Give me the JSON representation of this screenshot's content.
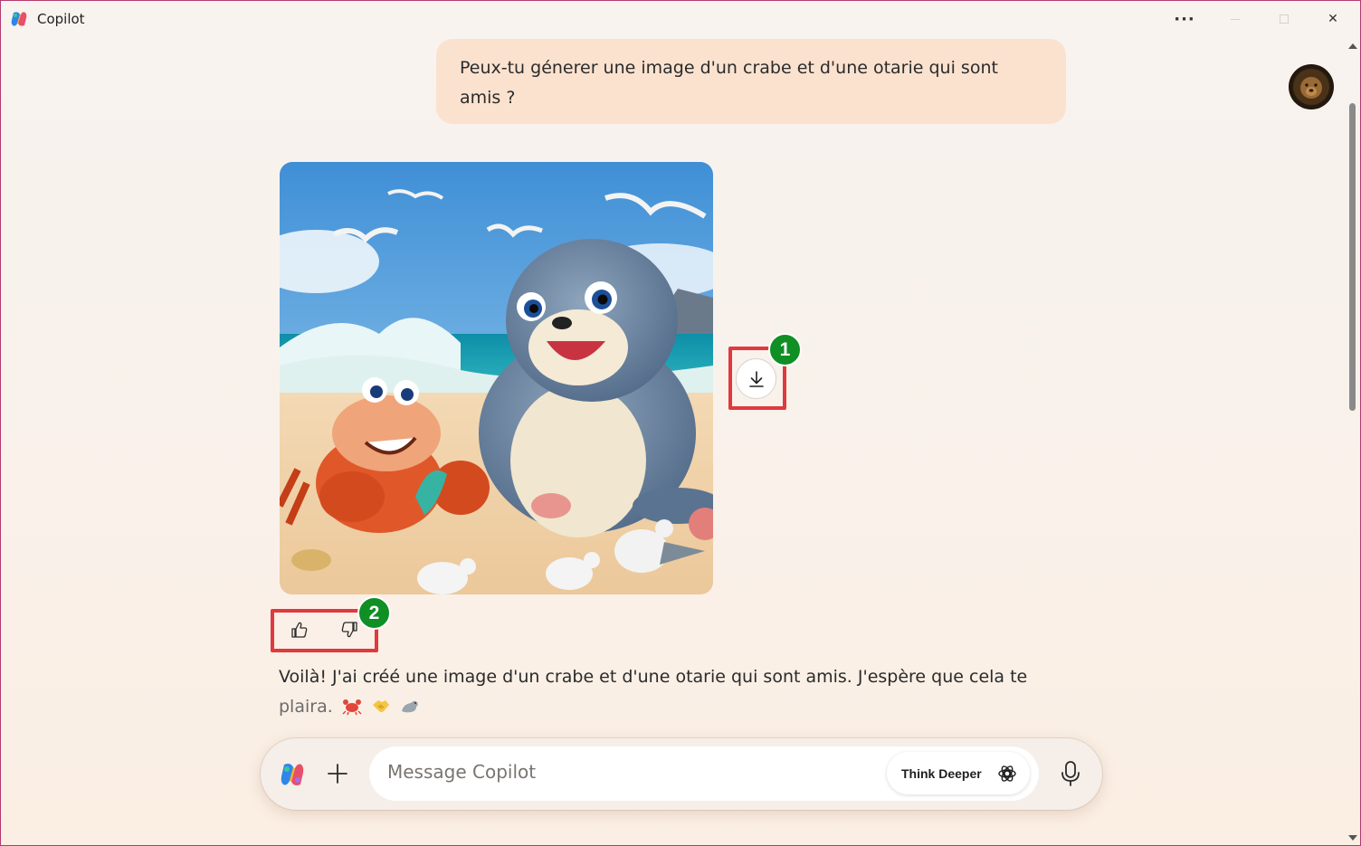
{
  "app": {
    "title": "Copilot",
    "more_glyph": "···",
    "close_glyph": "✕"
  },
  "conversation": {
    "user_message": "Peux-tu génerer une image d'un crabe et d'une otarie qui sont amis ?",
    "response_line1": "Voilà! J'ai créé une image d'un crabe et d'une otarie qui sont amis. J'espère que cela te",
    "response_line2": "plaira.",
    "response_emojis": [
      "crab",
      "handshake",
      "seal"
    ]
  },
  "annotations": {
    "badge_1": "1",
    "badge_2": "2"
  },
  "composer": {
    "placeholder": "Message Copilot",
    "think_deeper_label": "Think Deeper"
  },
  "colors": {
    "accent_annotation": "#e0393e",
    "badge_green": "#0f8f24",
    "user_bubble": "#fbe2cf"
  },
  "icons": [
    "copilot-logo-icon",
    "more-icon",
    "minimize-icon",
    "maximize-icon",
    "close-icon",
    "download-icon",
    "thumbs-up-icon",
    "thumbs-down-icon",
    "plus-icon",
    "think-deeper-icon",
    "microphone-icon"
  ]
}
